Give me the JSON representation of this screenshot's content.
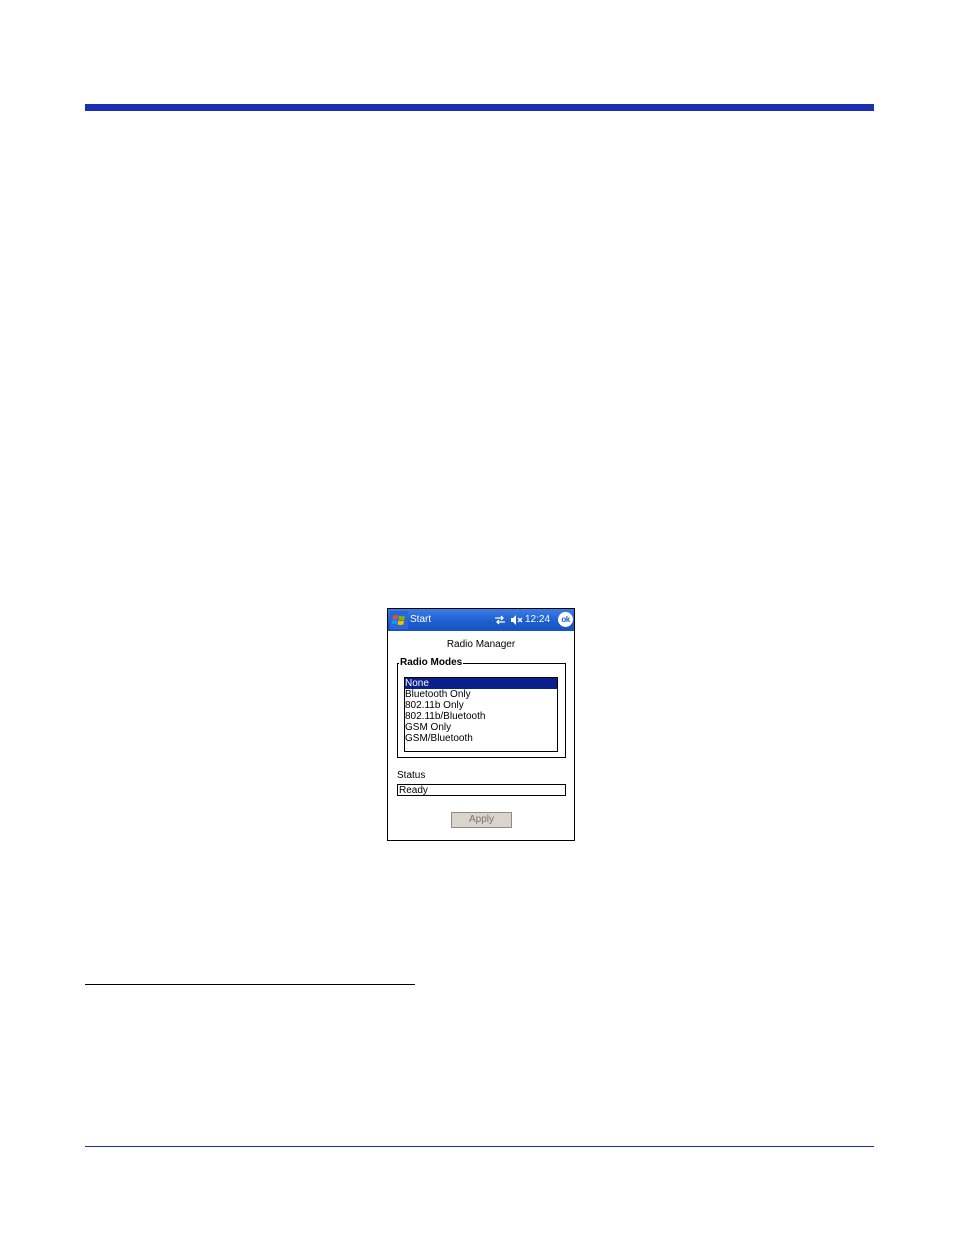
{
  "taskbar": {
    "start_label": "Start",
    "time": "12:24",
    "ok_label": "ok",
    "icons": [
      "windows-flag-icon",
      "connectivity-icon",
      "volume-muted-icon"
    ]
  },
  "app": {
    "title": "Radio Manager"
  },
  "radio_modes": {
    "label": "Radio Modes",
    "items": [
      {
        "label": "None"
      },
      {
        "label": "Bluetooth Only"
      },
      {
        "label": "802.11b Only"
      },
      {
        "label": "802.11b/Bluetooth"
      },
      {
        "label": "GSM Only"
      },
      {
        "label": "GSM/Bluetooth"
      }
    ],
    "selected": "None"
  },
  "status": {
    "label": "Status",
    "value": "Ready"
  },
  "actions": {
    "apply_label": "Apply"
  },
  "colors": {
    "taskbar": "#1d5fcf",
    "selection": "#0a1e8c",
    "page_rule": "#1a2fb4"
  }
}
